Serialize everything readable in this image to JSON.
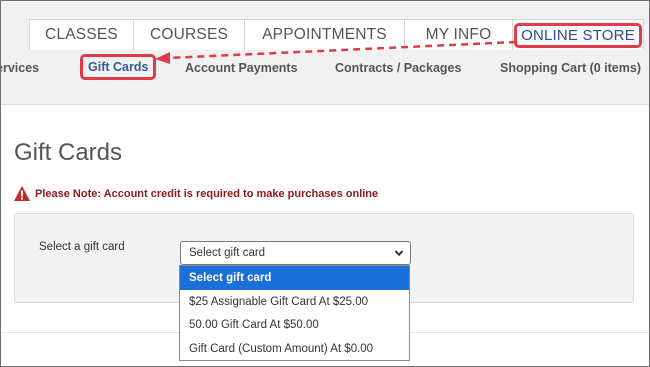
{
  "tabs": [
    {
      "label": "CLASSES"
    },
    {
      "label": "COURSES"
    },
    {
      "label": "APPOINTMENTS"
    },
    {
      "label": "MY INFO"
    },
    {
      "label": "ONLINE STORE"
    }
  ],
  "subnav": [
    {
      "label": "ervices"
    },
    {
      "label": "Gift Cards"
    },
    {
      "label": "Account Payments"
    },
    {
      "label": "Contracts / Packages"
    },
    {
      "label": "Shopping Cart (0 items)"
    }
  ],
  "page": {
    "title": "Gift Cards",
    "warning": "Please Note: Account credit is required to make purchases online",
    "select_label": "Select a gift card",
    "select_value": "Select gift card"
  },
  "dropdown": {
    "options": [
      {
        "label": "Select gift card",
        "selected": true
      },
      {
        "label": "$25 Assignable Gift Card At  $25.00"
      },
      {
        "label": "50.00 Gift Card At  $50.00"
      },
      {
        "label": "Gift Card (Custom Amount) At  $0.00"
      }
    ]
  },
  "colors": {
    "highlight": "#e03b4b",
    "selected_option": "#1a6fd8",
    "warning_text": "#8b1a1a"
  },
  "icons": {
    "warning": "warning-triangle-icon",
    "chevron": "chevron-down-icon",
    "arrow": "dashed-arrow-annotation"
  }
}
